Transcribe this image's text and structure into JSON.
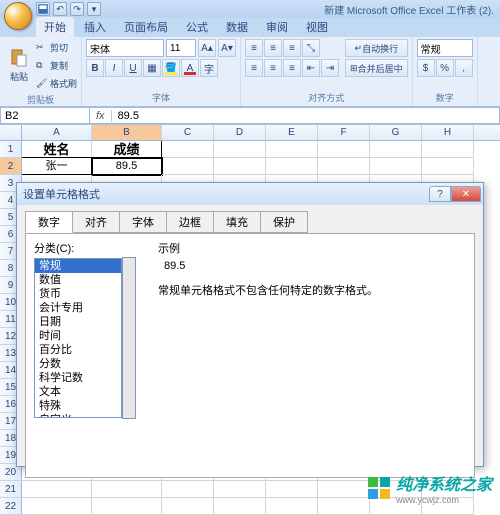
{
  "app": {
    "title": "新建 Microsoft Office Excel 工作表 (2)."
  },
  "ribbon": {
    "tabs": [
      "开始",
      "插入",
      "页面布局",
      "公式",
      "数据",
      "审阅",
      "视图"
    ],
    "active_tab": "开始",
    "clipboard": {
      "paste": "粘贴",
      "cut": "剪切",
      "copy": "复制",
      "format_painter": "格式刷",
      "group": "剪贴板"
    },
    "font": {
      "name": "宋体",
      "size": "11",
      "group": "字体"
    },
    "align": {
      "wrap": "自动换行",
      "merge": "合并后居中",
      "group": "对齐方式"
    },
    "number": {
      "format": "常规",
      "group": "数字"
    }
  },
  "formula_bar": {
    "name_box": "B2",
    "fx": "fx",
    "value": "89.5"
  },
  "sheet": {
    "cols": [
      "A",
      "B",
      "C",
      "D",
      "E",
      "F",
      "G",
      "H"
    ],
    "rows": [
      "1",
      "2",
      "3",
      "4",
      "5",
      "6",
      "7",
      "8",
      "9",
      "10",
      "11",
      "12",
      "13",
      "14",
      "15",
      "16",
      "17",
      "18",
      "19",
      "20",
      "21",
      "22"
    ],
    "a1": "姓名",
    "b1": "成绩",
    "a2": "张一",
    "b2": "89.5",
    "selected": "B2"
  },
  "chart_data": {
    "type": "table",
    "title": "",
    "columns": [
      "姓名",
      "成绩"
    ],
    "rows": [
      [
        "张一",
        89.5
      ]
    ]
  },
  "dialog": {
    "title": "设置单元格格式",
    "tabs": [
      "数字",
      "对齐",
      "字体",
      "边框",
      "填充",
      "保护"
    ],
    "active_tab": "数字",
    "category_label": "分类(C):",
    "categories": [
      "常规",
      "数值",
      "货币",
      "会计专用",
      "日期",
      "时间",
      "百分比",
      "分数",
      "科学记数",
      "文本",
      "特殊",
      "自定义"
    ],
    "selected_category": "常规",
    "example_label": "示例",
    "example_value": "89.5",
    "description": "常规单元格格式不包含任何特定的数字格式。"
  },
  "watermark": "纯净系统之家",
  "watermark_url": "www.ycwjz.com"
}
